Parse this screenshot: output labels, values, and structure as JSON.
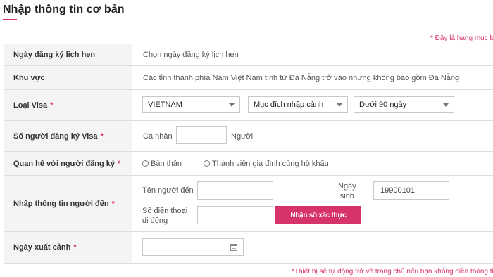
{
  "header": {
    "title": "Nhập thông tin cơ bản",
    "required_note": "* Đây là hạng mục bắ"
  },
  "form": {
    "appointment_date": {
      "label": "Ngày đăng ký lịch hẹn",
      "value": "Chọn ngày đăng ký lịch hẹn"
    },
    "region": {
      "label": "Khu vực",
      "value": "Các tỉnh thành phía Nam Việt Nam tính từ Đà Nẵng trở vào nhưng không bao gồm Đà Nẵng"
    },
    "visa_type": {
      "label": "Loại Visa",
      "required_mark": "*",
      "nationality": "VIETNAM",
      "purpose": "Mục đích nhập cảnh",
      "duration": "Dưới 90 ngày"
    },
    "applicant_count": {
      "label": "Số người đăng ký Visa",
      "required_mark": "*",
      "prefix": "Cá nhân",
      "value": "",
      "suffix": "Người"
    },
    "relationship": {
      "label": "Quan hệ với người đăng ký",
      "required_mark": "*",
      "options": [
        "Bản thân",
        "Thành viên gia đình cùng hộ khẩu"
      ]
    },
    "arrival_info": {
      "label": "Nhập thông tin người đến",
      "required_mark": "*",
      "name_label": "Tên người đến",
      "name_value": "",
      "birthdate_label_line1": "Ngày",
      "birthdate_label_line2": "sinh",
      "birthdate_value": "19900101",
      "phone_label_line1": "Số điện thoại",
      "phone_label_line2": "di động",
      "phone_value": "",
      "verify_button": "Nhận số xác thực"
    },
    "departure_date": {
      "label": "Ngày xuất cảnh",
      "required_mark": "*",
      "value": ""
    }
  },
  "footer": {
    "note": "*Thiết bị sẽ tự động trở về trang chủ nếu bạn không điền thông tin hơ"
  },
  "colors": {
    "accent": "#d6336c",
    "label_bg": "#f4f4f4",
    "border": "#dddddd"
  }
}
